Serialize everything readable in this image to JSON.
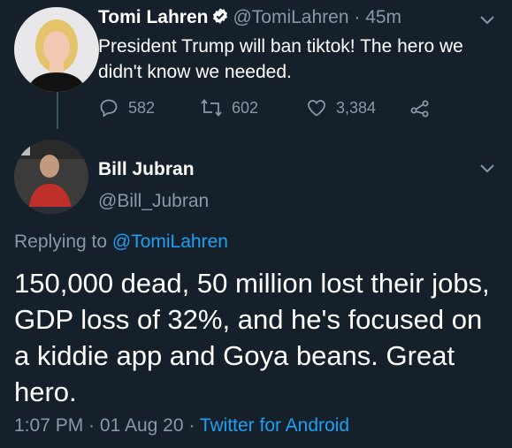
{
  "parent_tweet": {
    "name": "Tomi Lahren",
    "handle": "@TomiLahren",
    "separator": "·",
    "time": "45m",
    "text": "President Trump will ban tiktok! The hero we didn't know we needed.",
    "replies": "582",
    "retweets": "602",
    "likes": "3,384",
    "verified": true
  },
  "reply_tweet": {
    "name": "Bill Jubran",
    "handle": "@Bill_Jubran",
    "replying_label": "Replying to",
    "replying_to": "@TomiLahren",
    "text": "150,000 dead, 50 million lost their jobs, GDP loss of 32%, and he's focused on a kiddie app and Goya beans.  Great hero.",
    "time": "1:07 PM",
    "separator": "·",
    "date": "01 Aug 20",
    "source": "Twitter for Android"
  },
  "colors": {
    "background": "#15202b",
    "muted": "#8899a6",
    "link": "#1da1f2"
  }
}
